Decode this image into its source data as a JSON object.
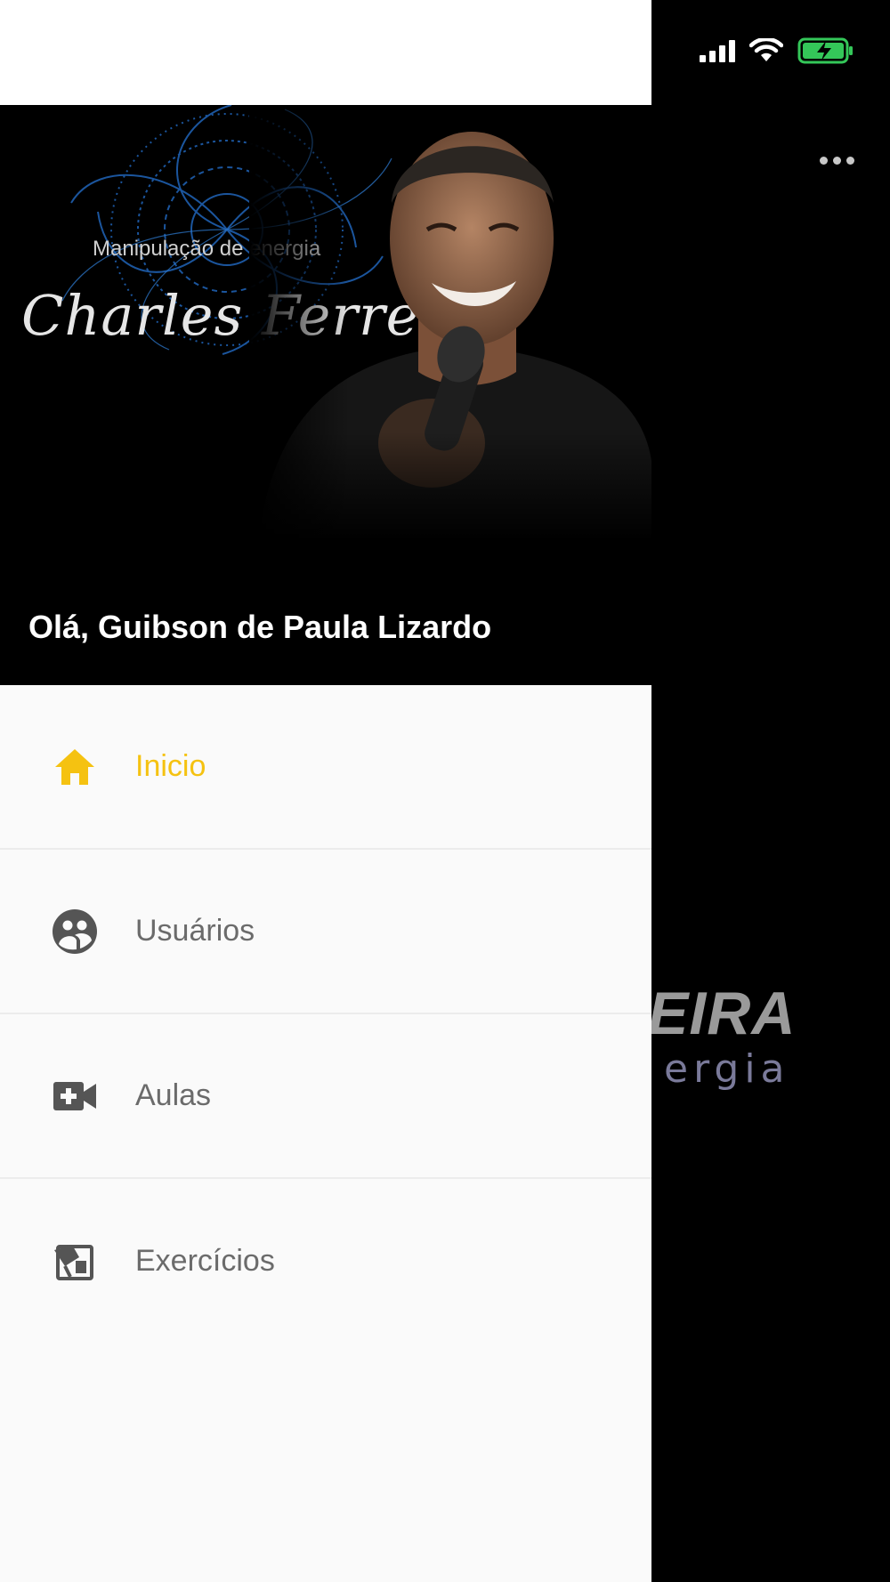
{
  "header": {
    "brand_name": "Charles Ferreira",
    "brand_tagline": "Manipulação de energia",
    "greeting": "Olá, Guibson de Paula Lizardo"
  },
  "menu": {
    "items": [
      {
        "label": "Inicio",
        "icon": "home-icon",
        "active": true
      },
      {
        "label": "Usuários",
        "icon": "users-icon",
        "active": false
      },
      {
        "label": "Aulas",
        "icon": "video-add-icon",
        "active": false
      },
      {
        "label": "Exercícios",
        "icon": "exercise-icon",
        "active": false
      }
    ]
  },
  "background_app": {
    "logo_text": "EIRA",
    "logo_subtext": "ergia"
  },
  "colors": {
    "accent": "#f5c211",
    "drawer_bg": "#fafafa",
    "header_bg": "#000000",
    "menu_text": "#6b6b6b",
    "icon_gray": "#555555",
    "battery_green": "#34c759"
  }
}
